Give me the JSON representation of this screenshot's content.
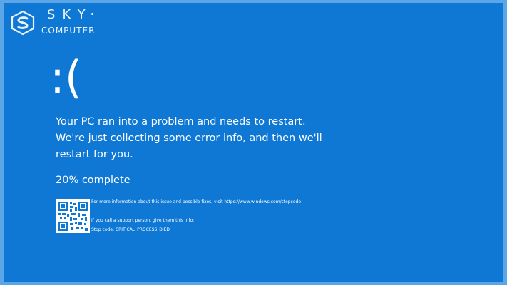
{
  "watermark": {
    "brand_top": "SKY",
    "brand_bottom": "COMPUTER"
  },
  "crash_screen": {
    "emoticon": ":(",
    "message": "Your PC ran into a problem and needs to restart. We're just collecting some error info, and then we'll restart for you.",
    "progress_text": "20% complete",
    "more_info": "For more information about this issue and possible fixes, visit https://www.windows.com/stopcode",
    "support_note": "If you call a support person, give them this info:",
    "stop_code": "Stop code: CRITICAL_PROCESS_DIED"
  },
  "colors": {
    "background": "#0f78d4",
    "frame": "#5aa6e6",
    "text": "#ffffff"
  },
  "icons": {
    "qr_code": "qr-code-icon",
    "logo": "sky-computer-logo-icon"
  }
}
